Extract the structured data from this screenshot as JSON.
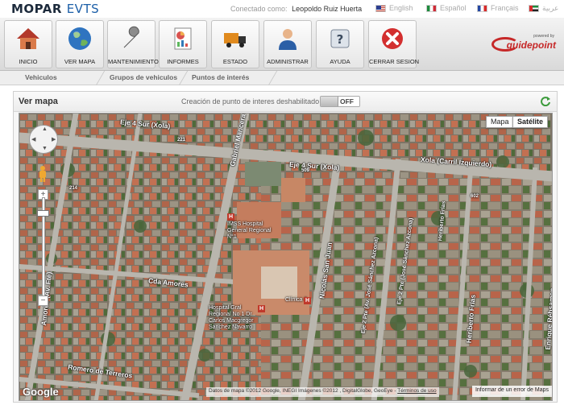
{
  "header": {
    "logo_brand": "MOPAR",
    "logo_product": "EVTS",
    "connected_label": "Conectado como:",
    "user_name": "Leopoldo Ruiz Huerta",
    "languages": [
      {
        "label": "English",
        "flag": "us"
      },
      {
        "label": "Español",
        "flag": "mx"
      },
      {
        "label": "Français",
        "flag": "fr"
      },
      {
        "label": "عربية",
        "flag": "ae"
      }
    ]
  },
  "toolbar": {
    "buttons": [
      {
        "label": "INICIO",
        "icon": "home-icon"
      },
      {
        "label": "VER MAPA",
        "icon": "globe-icon"
      },
      {
        "label": "MANTENIMIENTO",
        "icon": "wrench-icon"
      },
      {
        "label": "INFORMES",
        "icon": "report-icon"
      },
      {
        "label": "ESTADO",
        "icon": "truck-icon"
      },
      {
        "label": "ADMINISTRAR",
        "icon": "user-icon"
      },
      {
        "label": "AYUDA",
        "icon": "help-icon"
      },
      {
        "label": "CERRAR SESION",
        "icon": "close-icon"
      }
    ],
    "partner_logo": "guidepoint",
    "partner_tagline": "powered by"
  },
  "subtabs": [
    "Vehiculos",
    "Grupos de vehiculos",
    "Puntos de interés"
  ],
  "panel": {
    "title": "Ver mapa",
    "poi_label": "Creación de punto de interes deshabilitado",
    "toggle_state": "OFF"
  },
  "map": {
    "type_buttons": [
      "Mapa",
      "Satélite"
    ],
    "active_type": "Satélite",
    "streets": [
      "Eje 4 Sur (Xola)",
      "Xola (Carril Izquierdo)",
      "Eje 4 Sur (Xola)",
      "Gabriel Mancera",
      "Nicolás San Juan",
      "Cda Amores",
      "Amores (Av. Fte)",
      "Heriberto Frías",
      "Enrique Rébsamen",
      "Romero de Terreros",
      "Eje 2 Pte (Av. José Sánchez Azcona)",
      "Eje 2 Pte (José Sánchez Azcona)",
      "Heriberto Frías"
    ],
    "road_numbers": [
      "509",
      "221",
      "214",
      "602"
    ],
    "pois": [
      "IMSS Hospital General Regional N°1",
      "Hospital Gral Regional No 1 Dr Carlos Macgregor Sánchez Navarro",
      "Clínica 8"
    ],
    "google_logo": "Google",
    "attribution": "Datos de mapa ©2012 Google, INEGI Imágenes ©2012 , DigitalGlobe, GeoEye",
    "terms_link": "Términos de uso",
    "report_link": "Informar de un error de Maps"
  },
  "colors": {
    "accent_red": "#c62828",
    "brand_blue": "#1c5fa8"
  }
}
